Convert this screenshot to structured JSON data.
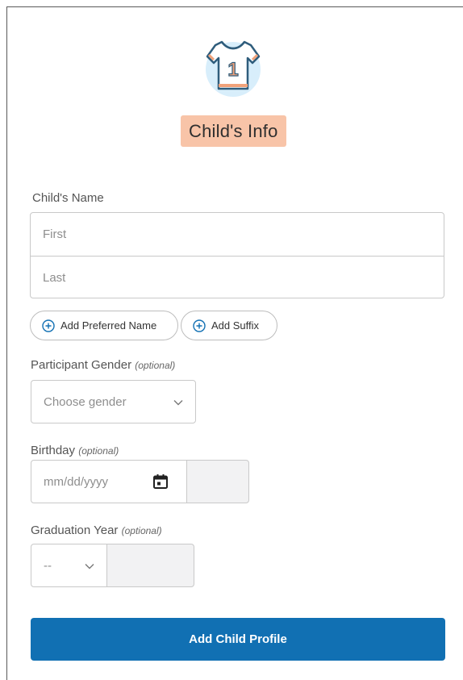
{
  "header": {
    "icon": "jersey-icon",
    "jersey_number": "1",
    "title": "Child's Info"
  },
  "colors": {
    "title_badge": "#f8c4a8",
    "primary": "#1170b3",
    "icon_circle": "#d8eefb",
    "icon_outline": "#2f5d7c",
    "icon_accent": "#f1a27a"
  },
  "childs_name": {
    "label": "Child's Name",
    "first_placeholder": "First",
    "last_placeholder": "Last"
  },
  "extras": {
    "preferred_name_label": "Add Preferred Name",
    "suffix_label": "Add Suffix"
  },
  "gender": {
    "label": "Participant Gender",
    "optional": "(optional)",
    "placeholder": "Choose gender"
  },
  "birthday": {
    "label": "Birthday",
    "optional": "(optional)",
    "placeholder": "mm/dd/yyyy"
  },
  "graduation": {
    "label": "Graduation Year",
    "optional": "(optional)",
    "selected": "--"
  },
  "submit": {
    "label": "Add Child Profile"
  }
}
